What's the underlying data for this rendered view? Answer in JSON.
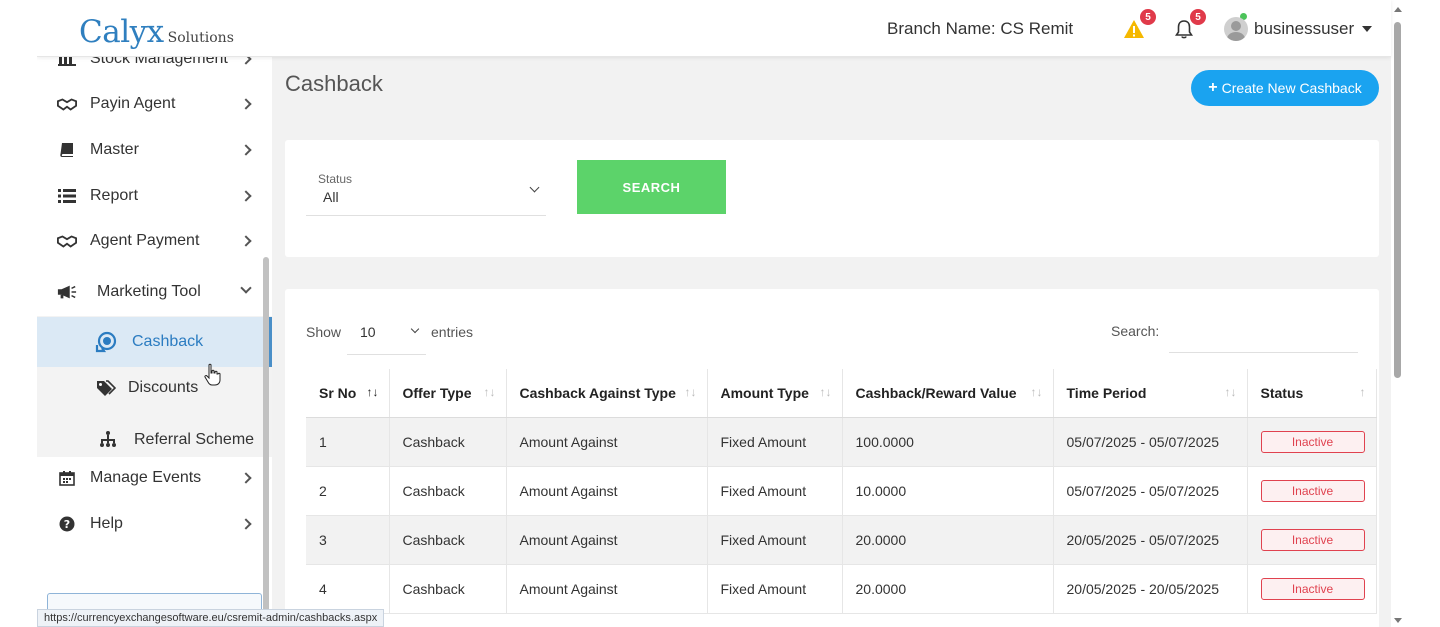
{
  "header": {
    "logo_main": "Calyx",
    "logo_sub": "Solutions",
    "branch_text": "Branch Name: CS Remit",
    "alert_count": "5",
    "notification_count": "5",
    "username": "businessuser"
  },
  "sidebar": {
    "items": [
      {
        "label": "Stock Management",
        "icon": "stock-icon"
      },
      {
        "label": "Payin Agent",
        "icon": "handshake-icon"
      },
      {
        "label": "Master",
        "icon": "book-icon"
      },
      {
        "label": "Report",
        "icon": "list-icon"
      },
      {
        "label": "Agent Payment",
        "icon": "handshake-icon"
      },
      {
        "label": "Marketing Tool",
        "icon": "megaphone-icon"
      },
      {
        "label": "Manage Events",
        "icon": "calendar-icon"
      },
      {
        "label": "Help",
        "icon": "question-icon"
      }
    ],
    "submenu": [
      {
        "label": "Cashback",
        "icon": "cashback-icon",
        "active": true
      },
      {
        "label": "Discounts",
        "icon": "tags-icon"
      },
      {
        "label": "Referral Scheme",
        "icon": "sitemap-icon"
      }
    ]
  },
  "main": {
    "title": "Cashback",
    "create_button": "Create New Cashback",
    "filter": {
      "status_label": "Status",
      "status_value": "All",
      "search_button": "SEARCH"
    },
    "table": {
      "show_label": "Show",
      "page_length": "10",
      "entries_label": "entries",
      "search_label": "Search:",
      "columns": [
        "Sr No",
        "Offer Type",
        "Cashback Against Type",
        "Amount Type",
        "Cashback/Reward Value",
        "Time Period",
        "Status"
      ],
      "rows": [
        [
          "1",
          "Cashback",
          "Amount Against",
          "Fixed Amount",
          "100.0000",
          "05/07/2025 - 05/07/2025",
          "Inactive"
        ],
        [
          "2",
          "Cashback",
          "Amount Against",
          "Fixed Amount",
          "10.0000",
          "05/07/2025 - 05/07/2025",
          "Inactive"
        ],
        [
          "3",
          "Cashback",
          "Amount Against",
          "Fixed Amount",
          "20.0000",
          "20/05/2025 - 05/07/2025",
          "Inactive"
        ],
        [
          "4",
          "Cashback",
          "Amount Against",
          "Fixed Amount",
          "20.0000",
          "20/05/2025 - 20/05/2025",
          "Inactive"
        ]
      ]
    }
  },
  "status_url": "https://currencyexchangesoftware.eu/csremit-admin/cashbacks.aspx",
  "colors": {
    "accent": "#1aa3f0",
    "search_button": "#5cd36a",
    "inactive": "#e0424f",
    "active_menu_bg": "#dbe9f5",
    "badge": "#e03a4a"
  }
}
